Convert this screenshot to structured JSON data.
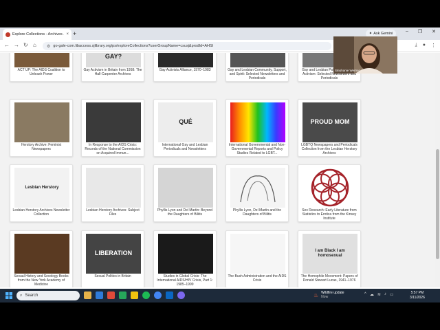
{
  "browser": {
    "tab_title": "Explore Collections - Archives ...",
    "tab_close": "×",
    "new_tab": "+",
    "ask_gemini": "Ask Gemini",
    "window_controls": [
      "–",
      "❐",
      "✕"
    ],
    "url": "go-gale-com.libaccess.sjlibrary.org/ps/exploreCollections?userGroupName=csusj&prodId=AHSI"
  },
  "webcam": {
    "name": "Stephanie Werner"
  },
  "collections": [
    {
      "title": "ACT UP: The AIDS Coalition to Unleash Power",
      "thumb_text": "",
      "thumb_color": "#7a5a3a"
    },
    {
      "title": "Gay Activism in Britain from 1958: The Hall-Carpenter Archives",
      "thumb_text": "GAY?",
      "thumb_color": "#dcdcdc"
    },
    {
      "title": "Gay Activists Alliance, 1970–1983",
      "thumb_text": "",
      "thumb_color": "#2a2a2a"
    },
    {
      "title": "Gay and Lesbian Community, Support, and Spirit: Selected Newsletters and Periodicals",
      "thumb_text": "",
      "thumb_color": "#555555"
    },
    {
      "title": "Gay and Lesbian Politics and Social Activism: Selected Newsletters and Periodicals",
      "thumb_text": "",
      "thumb_color": "#777777"
    },
    {
      "title": "Herstory Archive: Feminist Newspapers",
      "thumb_text": "",
      "thumb_color": "#8a7a62"
    },
    {
      "title": "In Response to the AIDS Crisis: Records of the National Commission on Acquired Immun...",
      "thumb_text": "",
      "thumb_color": "#3a3a3a"
    },
    {
      "title": "International Gay and Lesbian Periodicals and Newsletters",
      "thumb_text": "QUÉ",
      "thumb_color": "#ededed"
    },
    {
      "title": "International Governmental and Non-Governmental Reports and Policy Studies Related to LGBT...",
      "thumb_text": "",
      "thumb_color": "#ff0000"
    },
    {
      "title": "LGBTQ Newspapers and Periodicals Collection from the Lesbian Herstory Archives",
      "thumb_text": "PROUD MOM",
      "thumb_color": "#4a4a4a"
    },
    {
      "title": "Lesbian Herstory Archives Newsletter Collection",
      "thumb_text": "Lesbian Herstory",
      "thumb_color": "#f2f2f2"
    },
    {
      "title": "Lesbian Herstory Archives: Subject Files",
      "thumb_text": "",
      "thumb_color": "#e8e8e8"
    },
    {
      "title": "Phyllis Lyon and Del Martin: Beyond the Daughters of Bilitis",
      "thumb_text": "",
      "thumb_color": "#d5d5d5"
    },
    {
      "title": "Phyllis Lyon, Del Martin and the Daughters of Bilitis",
      "thumb_text": "",
      "thumb_color": "#f4f4f4"
    },
    {
      "title": "Sex Research: Early Literature from Statistics to Erotica from the Kinsey Institute",
      "thumb_text": "",
      "thumb_color": "#ffffff"
    },
    {
      "title": "Sexual History and Sexology Books from the New York Academy of Medicine",
      "thumb_text": "",
      "thumb_color": "#5a3a22"
    },
    {
      "title": "Sexual Politics in Britain",
      "thumb_text": "LIBERATION",
      "thumb_color": "#444444"
    },
    {
      "title": "Studies in Global Crisis: The International AIDS/HIV Crisis, Part 1: 1985–1999",
      "thumb_text": "",
      "thumb_color": "#1a1a1a"
    },
    {
      "title": "The Bush Administration and the AIDS Crisis",
      "thumb_text": "",
      "thumb_color": "#f6f6f6"
    },
    {
      "title": "The Homophile Movement: Papers of Donald Stewart Lucas, 1941–1976",
      "thumb_text": "I am Black I am homosexual",
      "thumb_color": "#e0e0e0"
    }
  ],
  "taskbar": {
    "search_label": "Search",
    "notification_title": "Wildfire update",
    "notification_sub": "Now",
    "time": "5:57 PM",
    "date": "3/11/2026"
  }
}
